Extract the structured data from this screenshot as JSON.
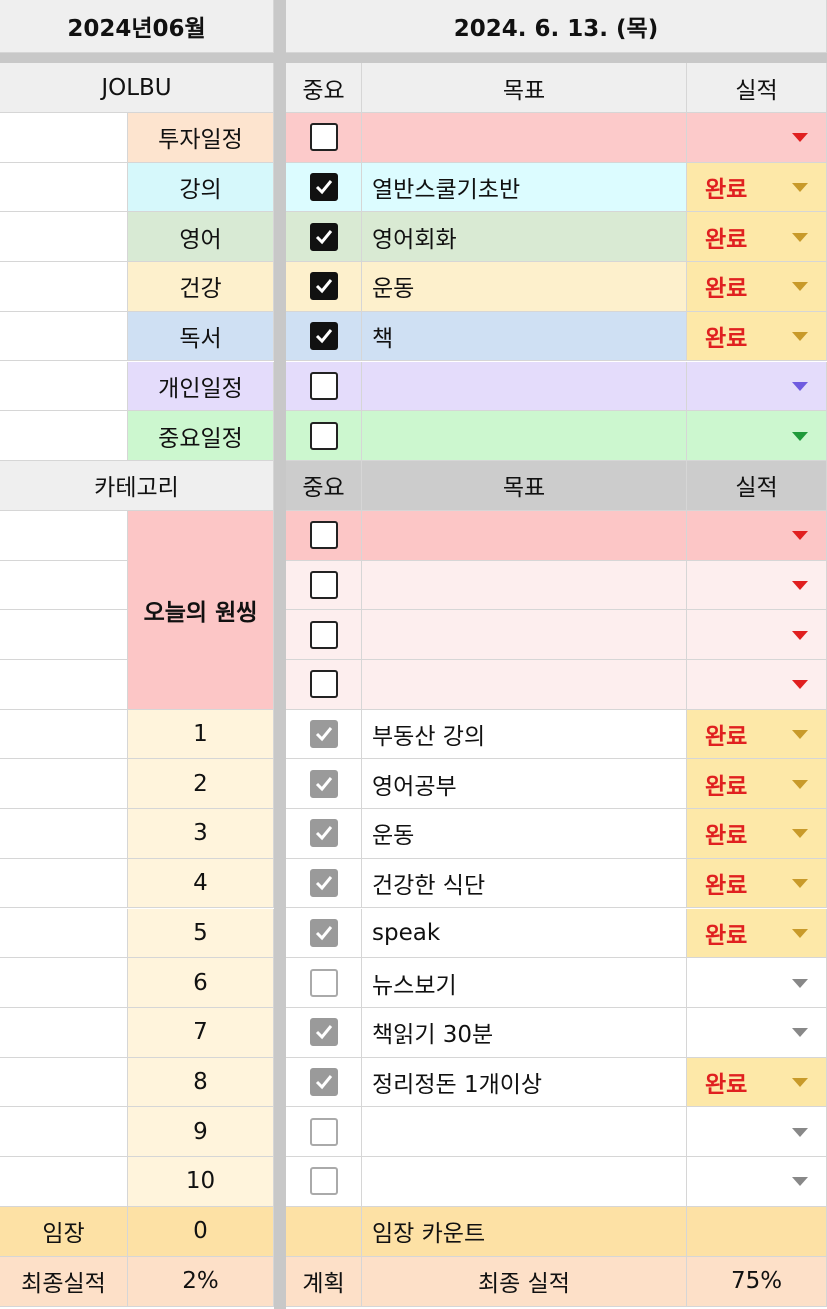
{
  "header": {
    "month": "2024년06월",
    "date": "2024. 6. 13. (목)"
  },
  "section1": {
    "left_header": "JOLBU",
    "col_important": "중요",
    "col_goal": "목표",
    "col_result": "실적",
    "rows": [
      {
        "category": "투자일정",
        "checked": false,
        "goal": "",
        "result": "",
        "cat_color": "#fde4cf",
        "goal_color": "#fccaca",
        "result_color": "#fccaca",
        "arrow_color": "#e02020"
      },
      {
        "category": "강의",
        "checked": true,
        "goal": "열반스쿨기초반",
        "result": "완료",
        "cat_color": "#d6f8fb",
        "goal_color": "#dcfcff",
        "result_color": "#fde8a8",
        "arrow_color": "#c89a2a"
      },
      {
        "category": "영어",
        "checked": true,
        "goal": "영어회화",
        "result": "완료",
        "cat_color": "#d8ead4",
        "goal_color": "#d9ead3",
        "result_color": "#fde8a8",
        "arrow_color": "#c89a2a"
      },
      {
        "category": "건강",
        "checked": true,
        "goal": "운동",
        "result": "완료",
        "cat_color": "#fdf0cc",
        "goal_color": "#fdf0cc",
        "result_color": "#fde8a8",
        "arrow_color": "#c89a2a"
      },
      {
        "category": "독서",
        "checked": true,
        "goal": "책",
        "result": "완료",
        "cat_color": "#cfe0f3",
        "goal_color": "#cfe0f3",
        "result_color": "#fde8a8",
        "arrow_color": "#c89a2a"
      },
      {
        "category": "개인일정",
        "checked": false,
        "goal": "",
        "result": "",
        "cat_color": "#e4dcfb",
        "goal_color": "#e4dcfb",
        "result_color": "#e4dcfb",
        "arrow_color": "#6f5be0"
      },
      {
        "category": "중요일정",
        "checked": false,
        "goal": "",
        "result": "",
        "cat_color": "#ccf7cf",
        "goal_color": "#ccf7cf",
        "result_color": "#ccf7cf",
        "arrow_color": "#1f9a3a"
      }
    ]
  },
  "section2": {
    "left_header": "카테고리",
    "col_important": "중요",
    "col_goal": "목표",
    "col_result": "실적",
    "onething_label": "오늘의 원씽",
    "onething_rows": [
      {
        "checked": false,
        "goal": "",
        "result": ""
      },
      {
        "checked": false,
        "goal": "",
        "result": ""
      },
      {
        "checked": false,
        "goal": "",
        "result": ""
      },
      {
        "checked": false,
        "goal": "",
        "result": ""
      }
    ],
    "rows": [
      {
        "num": "1",
        "checked": true,
        "goal": "부동산 강의",
        "result": "완료"
      },
      {
        "num": "2",
        "checked": true,
        "goal": "영어공부",
        "result": "완료"
      },
      {
        "num": "3",
        "checked": true,
        "goal": "운동",
        "result": "완료"
      },
      {
        "num": "4",
        "checked": true,
        "goal": "건강한 식단",
        "result": "완료"
      },
      {
        "num": "5",
        "checked": true,
        "goal": "speak",
        "result": "완료"
      },
      {
        "num": "6",
        "checked": false,
        "goal": "뉴스보기",
        "result": ""
      },
      {
        "num": "7",
        "checked": true,
        "goal": "책읽기 30분",
        "result": ""
      },
      {
        "num": "8",
        "checked": true,
        "goal": "정리정돈 1개이상",
        "result": "완료"
      },
      {
        "num": "9",
        "checked": false,
        "goal": "",
        "result": ""
      },
      {
        "num": "10",
        "checked": false,
        "goal": "",
        "result": ""
      }
    ]
  },
  "footer": {
    "imjang_label": "임장",
    "imjang_value": "0",
    "imjang_count_label": "임장 카운트",
    "final_label": "최종실적",
    "final_value": "2%",
    "plan_label": "계획",
    "final_result_label": "최종 실적",
    "final_result_value": "75%"
  },
  "colors": {
    "header_gray": "#efefef",
    "done_red": "#e02020",
    "result_yellow": "#fde8a8",
    "onething_pink": "#fcc6c6",
    "onething_light": "#fdeeee",
    "num_cream": "#fff4dc",
    "footer_yellow": "#fde1a5",
    "footer_peach": "#fde0c8"
  }
}
